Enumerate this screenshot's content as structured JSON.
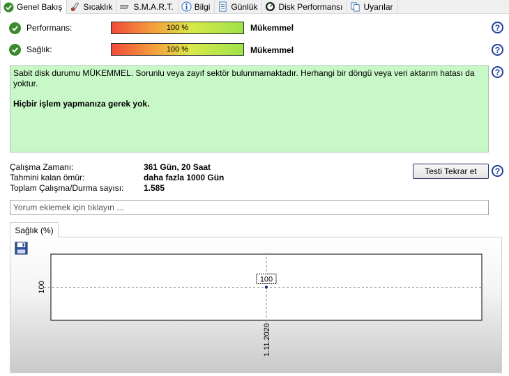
{
  "tabs": [
    {
      "label": "Genel Bakış",
      "icon": "check-circle-icon",
      "active": true
    },
    {
      "label": "Sıcaklık",
      "icon": "thermometer-icon",
      "active": false
    },
    {
      "label": "S.M.A.R.T.",
      "icon": "smart-drive-icon",
      "active": false
    },
    {
      "label": "Bilgi",
      "icon": "info-icon",
      "active": false
    },
    {
      "label": "Günlük",
      "icon": "log-document-icon",
      "active": false
    },
    {
      "label": "Disk Performansı",
      "icon": "speedometer-icon",
      "active": false
    },
    {
      "label": "Uyarılar",
      "icon": "copy-alerts-icon",
      "active": false
    }
  ],
  "performance": {
    "label": "Performans:",
    "value_text": "100 %",
    "value": 100,
    "verdict": "Mükemmel"
  },
  "health": {
    "label": "Sağlık:",
    "value_text": "100 %",
    "value": 100,
    "verdict": "Mükemmel"
  },
  "status": {
    "message": "Sabit disk durumu MÜKEMMEL. Sorunlu veya zayıf sektör bulunmamaktadır. Herhangi bir döngü veya veri aktarım hatası da yoktur.",
    "action": "Hiçbir işlem yapmanıza gerek yok."
  },
  "info": {
    "uptime_label": "Çalışma Zamanı:",
    "uptime_value": "361 Gün, 20 Saat",
    "remaining_label": "Tahmini kalan ömür:",
    "remaining_value": "daha fazla 1000 Gün",
    "cycles_label": "Toplam Çalışma/Durma sayısı:",
    "cycles_value": "1.585"
  },
  "retest_label": "Testi Tekrar et",
  "comment_placeholder": "Yorum eklemek için tıklayın ...",
  "health_tab_label": "Sağlık (%)",
  "help_label": "?",
  "colors": {
    "status_bg": "#c8f7c8",
    "check_green": "#3b8a2e",
    "help_blue": "#1f3f9e"
  },
  "chart_data": {
    "type": "line",
    "x": [
      "1.11.2020"
    ],
    "series": [
      {
        "values": [
          100
        ]
      }
    ],
    "ylim": [
      99,
      101
    ],
    "y_tick_labels": [
      "100"
    ],
    "data_labels": [
      "100"
    ],
    "grid": true
  }
}
